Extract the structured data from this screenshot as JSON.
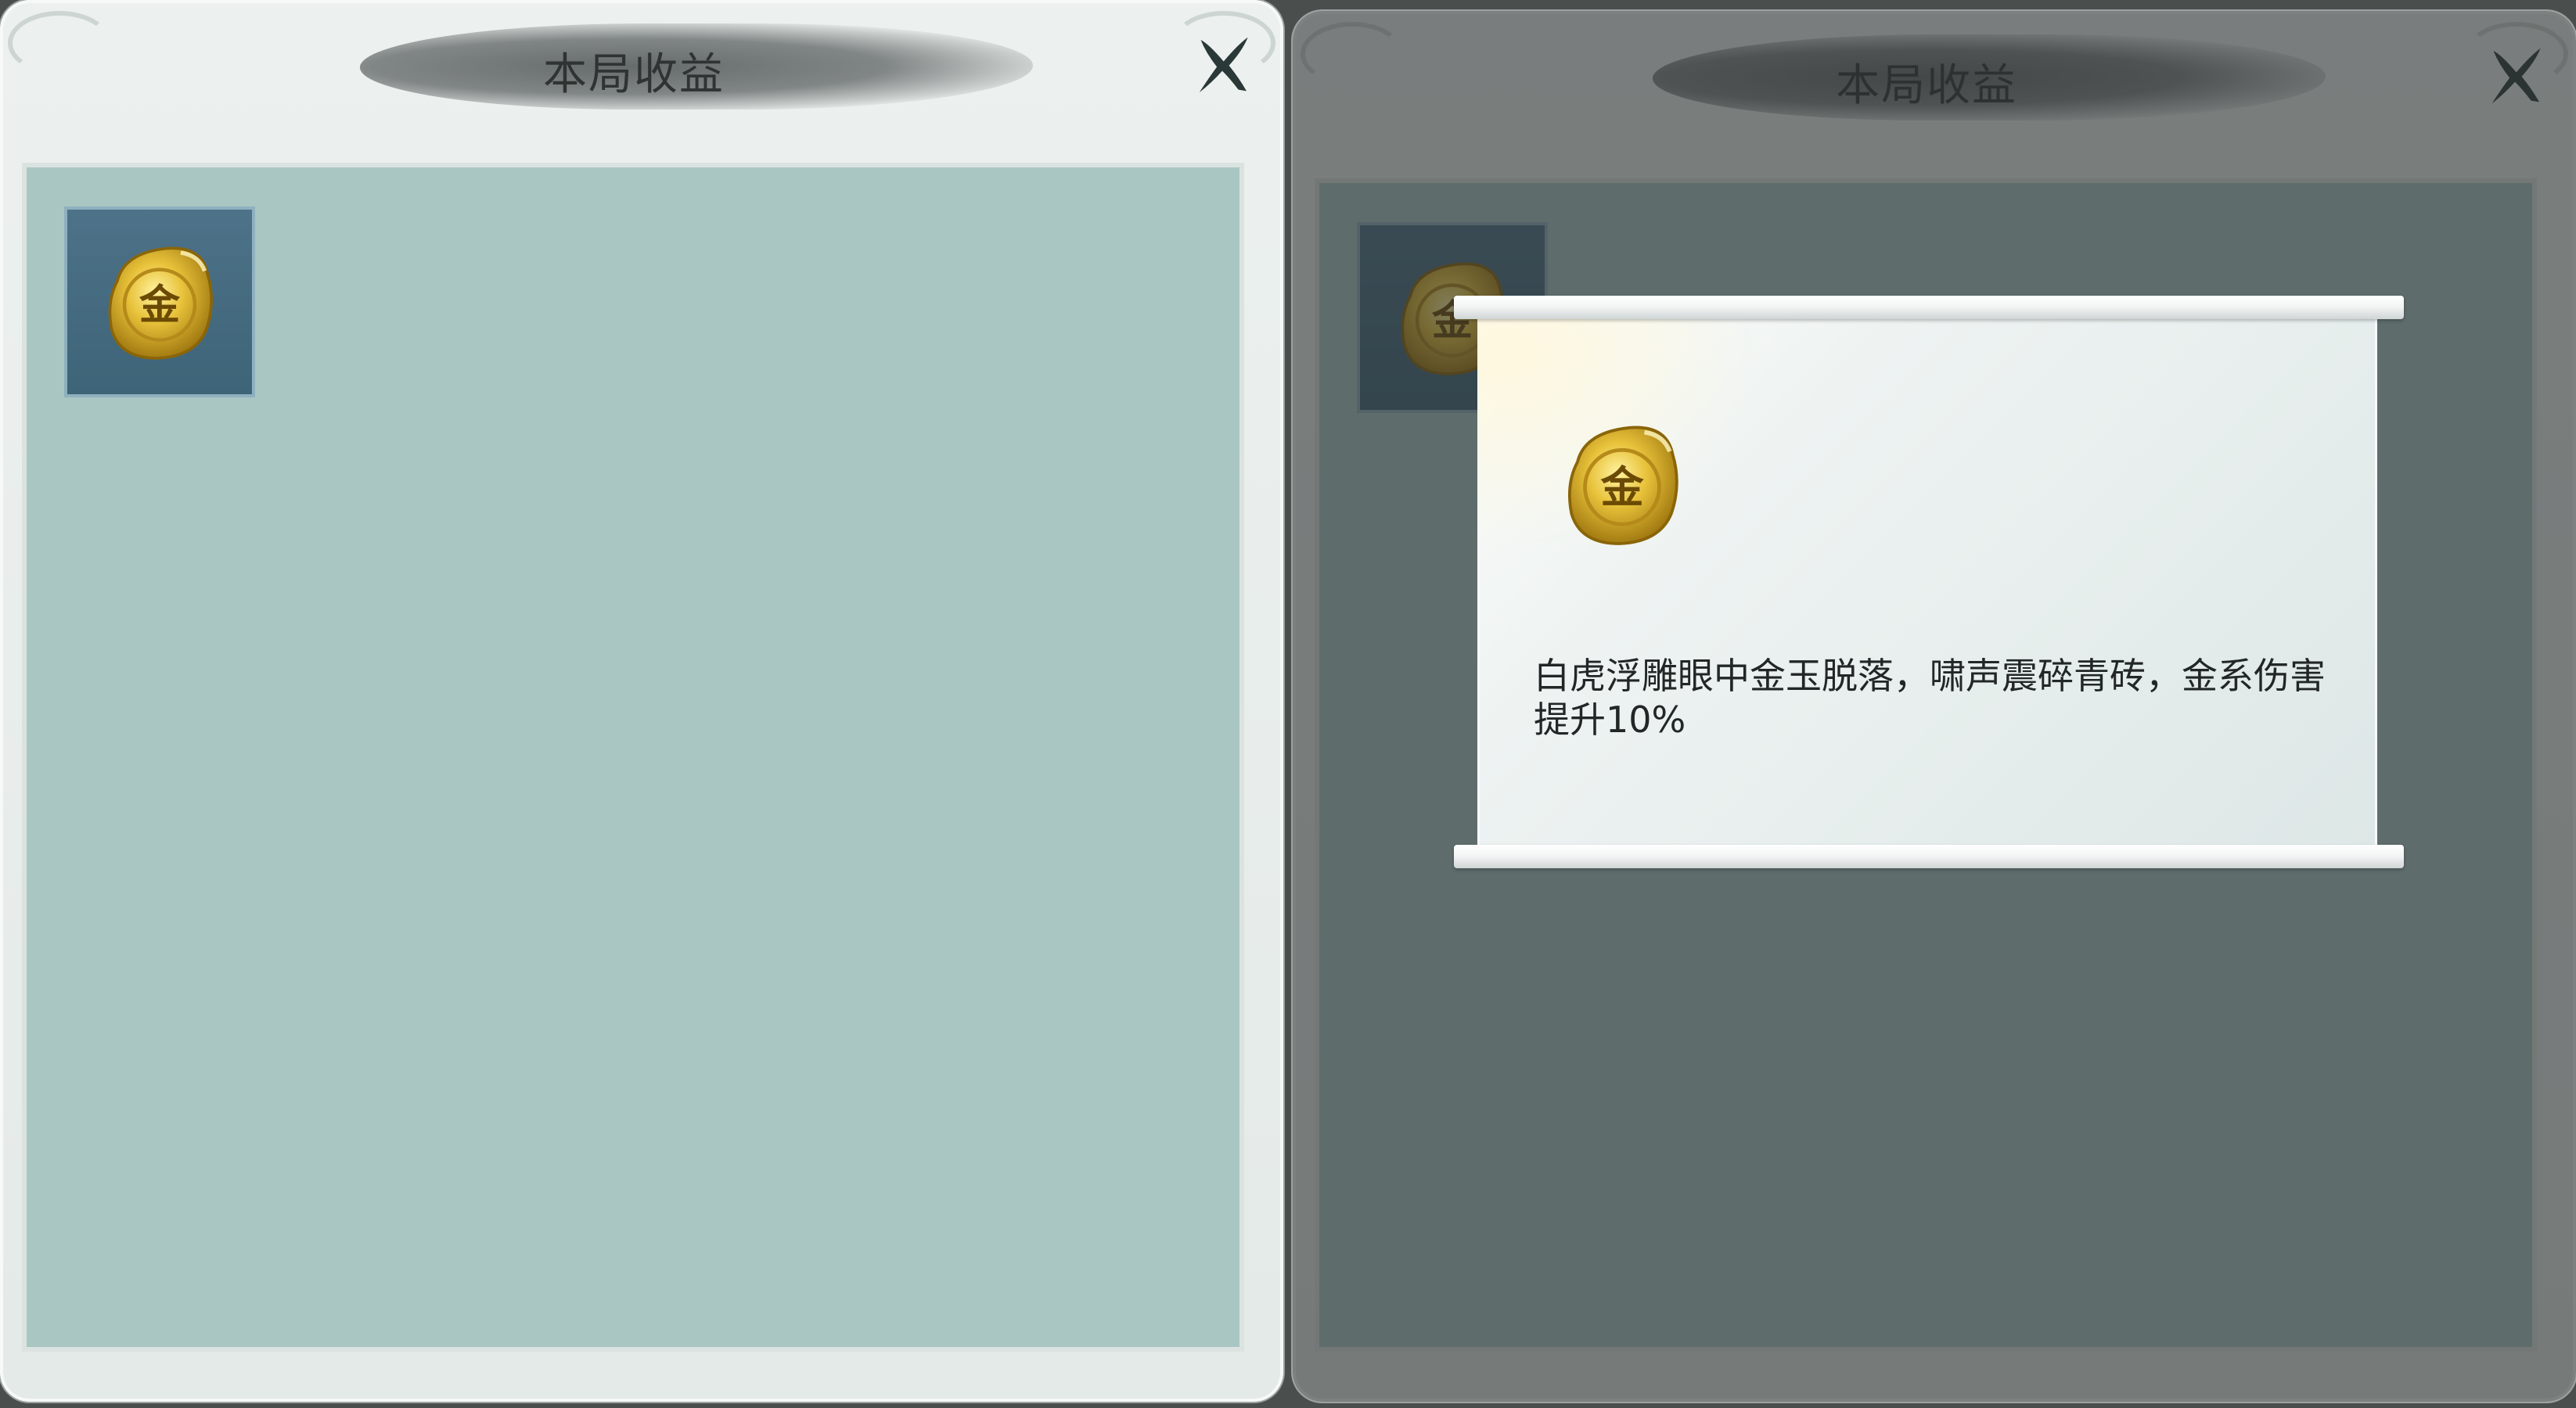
{
  "panels": [
    {
      "title": "本局收益",
      "close_icon": "close-x-icon",
      "items": [
        {
          "icon": "gold-coin-icon",
          "glyph": "金"
        }
      ]
    },
    {
      "title": "本局收益",
      "close_icon": "close-x-icon",
      "items": [
        {
          "icon": "gold-coin-icon",
          "glyph": "金"
        }
      ]
    }
  ],
  "tooltip": {
    "icon": "gold-coin-icon",
    "glyph": "金",
    "description": "白虎浮雕眼中金玉脱落，啸声震碎青砖，金系伤害提升10%"
  },
  "colors": {
    "content_bg": "#a9c6c3",
    "slot_bg": "#4d7289",
    "coin_gold": "#e8c23a",
    "coin_dark": "#a37b12",
    "title_ink": "#5f6464"
  }
}
